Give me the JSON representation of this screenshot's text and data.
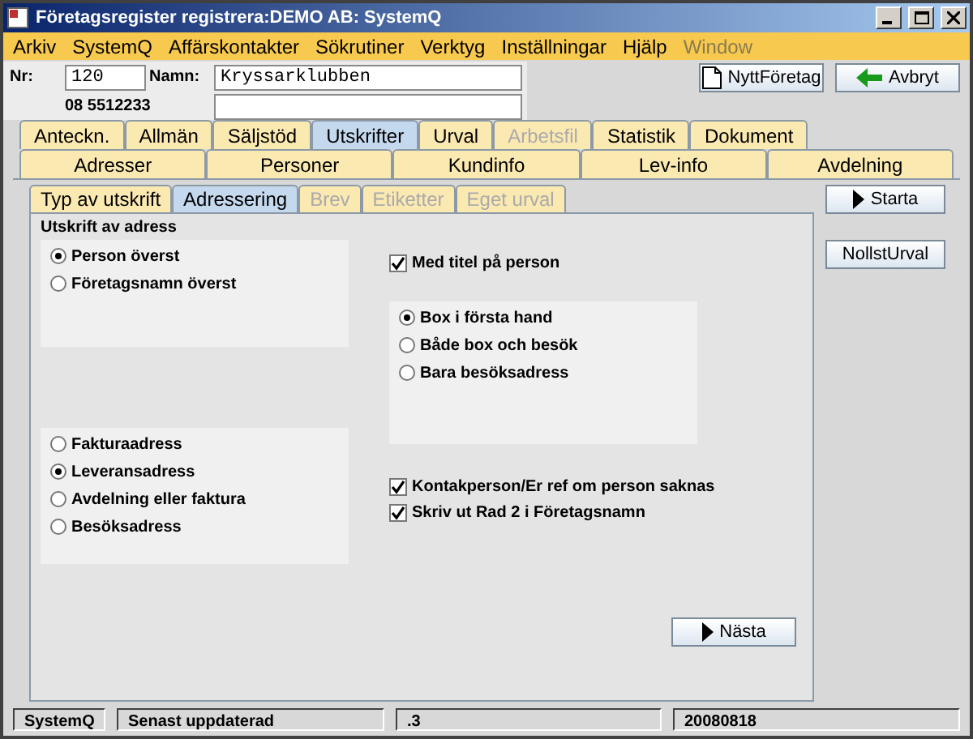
{
  "window": {
    "title": "Företagsregister registrera:DEMO AB: SystemQ"
  },
  "menu": [
    {
      "label": "Arkiv",
      "disabled": false
    },
    {
      "label": "SystemQ",
      "disabled": false
    },
    {
      "label": "Affärskontakter",
      "disabled": false
    },
    {
      "label": "Sökrutiner",
      "disabled": false
    },
    {
      "label": "Verktyg",
      "disabled": false
    },
    {
      "label": "Inställningar",
      "disabled": false
    },
    {
      "label": "Hjälp",
      "disabled": false
    },
    {
      "label": "Window",
      "disabled": true
    }
  ],
  "record": {
    "nr_label": "Nr:",
    "nr": "120",
    "name_label": "Namn:",
    "name": "Kryssarklubben",
    "phone": "08 5512233"
  },
  "toolbar": [
    {
      "label": "NyttFöretag",
      "kind": "new"
    },
    {
      "label": "Avbryt",
      "kind": "cancel"
    }
  ],
  "tabs_row_1": [
    {
      "label": "Anteckn.",
      "selected": false,
      "disabled": false
    },
    {
      "label": "Allmän",
      "selected": false,
      "disabled": false
    },
    {
      "label": "Säljstöd",
      "selected": false,
      "disabled": false
    },
    {
      "label": "Utskrifter",
      "selected": true,
      "disabled": false
    },
    {
      "label": "Urval",
      "selected": false,
      "disabled": false
    },
    {
      "label": "Arbetsfil",
      "selected": false,
      "disabled": true
    },
    {
      "label": "Statistik",
      "selected": false,
      "disabled": false
    },
    {
      "label": "Dokument",
      "selected": false,
      "disabled": false
    }
  ],
  "tabs_row_2": [
    {
      "label": "Adresser",
      "selected": false,
      "disabled": false
    },
    {
      "label": "Personer",
      "selected": false,
      "disabled": false
    },
    {
      "label": "Kundinfo",
      "selected": false,
      "disabled": false
    },
    {
      "label": "Lev-info",
      "selected": false,
      "disabled": false
    },
    {
      "label": "Avdelning",
      "selected": false,
      "disabled": false
    }
  ],
  "subtabs": [
    {
      "label": "Typ av utskrift",
      "selected": false,
      "disabled": false
    },
    {
      "label": "Adressering",
      "selected": true,
      "disabled": false
    },
    {
      "label": "Brev",
      "selected": false,
      "disabled": true
    },
    {
      "label": "Etiketter",
      "selected": false,
      "disabled": true
    },
    {
      "label": "Eget urval",
      "selected": false,
      "disabled": true
    }
  ],
  "panel": {
    "section_title": "Utskrift av adress",
    "top_options": [
      {
        "label": "Person överst",
        "selected": true
      },
      {
        "label": "Företagsnamn överst",
        "selected": false
      }
    ],
    "title_checkbox": {
      "label": "Med titel på person",
      "checked": true
    },
    "box_options": [
      {
        "label": "Box i första hand",
        "selected": true
      },
      {
        "label": "Både box och besök",
        "selected": false
      },
      {
        "label": "Bara besöksadress",
        "selected": false
      }
    ],
    "address_options": [
      {
        "label": "Fakturaadress",
        "selected": false
      },
      {
        "label": "Leveransadress",
        "selected": true
      },
      {
        "label": "Avdelning eller faktura",
        "selected": false
      },
      {
        "label": "Besöksadress",
        "selected": false
      }
    ],
    "checkboxes": [
      {
        "label": "Kontakperson/Er ref om person saknas",
        "checked": true
      },
      {
        "label": "Skriv ut Rad 2 i Företagsnamn",
        "checked": true
      }
    ],
    "next_button": "Nästa"
  },
  "side_buttons": [
    {
      "label": "Starta",
      "kind": "play"
    },
    {
      "label": "NollstUrval",
      "kind": "plain"
    }
  ],
  "status_bar": [
    "SystemQ",
    "Senast uppdaterad",
    ".3",
    "20080818"
  ]
}
